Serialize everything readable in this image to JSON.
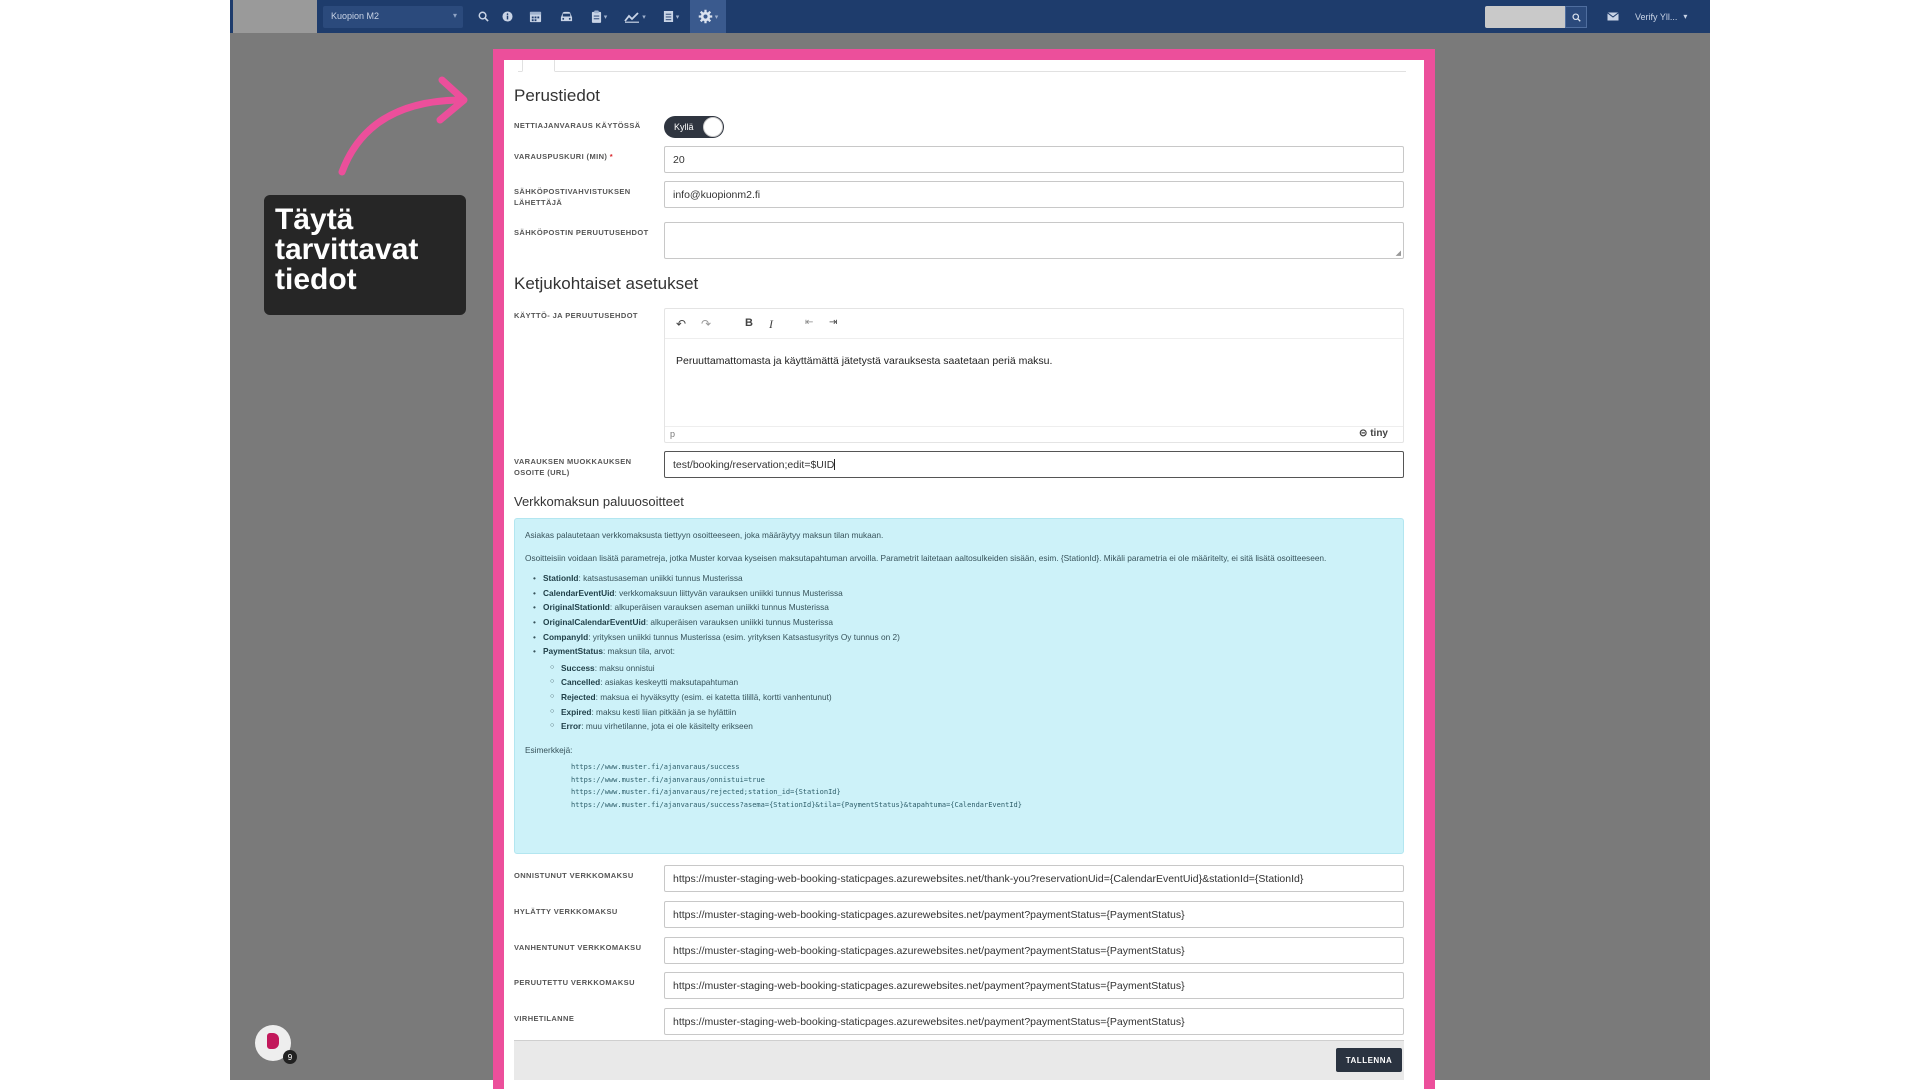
{
  "topbar": {
    "station": "Kuopion M2",
    "user": "Verify Yll...",
    "icons": [
      "search-icon",
      "info-icon",
      "calendar-icon",
      "car-icon",
      "clipboard-icon",
      "chart-icon",
      "list-icon",
      "gear-icon"
    ]
  },
  "annotation": {
    "callout_line1": "Täytä",
    "callout_line2": "tarvittavat",
    "callout_line3": "tiedot",
    "arrow_color": "#ec4f9b",
    "help_badge": "9"
  },
  "form": {
    "section_basic": "Perustiedot",
    "online_booking_label": "NETTIAJANVARAUS KÄYTÖSSÄ",
    "online_booking_value": "Kyllä",
    "buffer_label": "VARAUSPUSKURI (MIN)",
    "buffer_required": "*",
    "buffer_value": "20",
    "email_sender_label": "SÄHKÖPOSTIVAHVISTUKSEN LÄHETTÄJÄ",
    "email_sender_value": "info@kuopionm2.fi",
    "email_cancel_label": "SÄHKÖPOSTIN PERUUTUSEHDOT",
    "section_chain": "Ketjukohtaiset asetukset",
    "terms_label": "KÄYTTÖ- JA PERUUTUSEHDOT",
    "terms_text": "Peruuttamattomasta ja käyttämättä jätetystä varauksesta saatetaan periä maksu.",
    "editor_path": "p",
    "editor_brand": "tiny",
    "edit_url_label": "VARAUKSEN MUOKKAUKSEN OSOITE (URL)",
    "edit_url_value": "test/booking/reservation;edit=$UID",
    "section_payment": "Verkkomaksun paluuosoitteet",
    "info_p1": "Asiakas palautetaan verkkomaksusta tiettyyn osoitteeseen, joka määräytyy maksun tilan mukaan.",
    "info_p2": "Osoitteisiin voidaan lisätä parametreja, jotka Muster korvaa kyseisen maksutapahtuman arvoilla. Parametrit laitetaan aaltosulkeiden sisään, esim. {StationId}. Mikäli parametria ei ole määritelty, ei sitä lisätä osoitteeseen.",
    "params": [
      {
        "name": "StationId",
        "desc": ": katsastusaseman uniikki tunnus Musterissa"
      },
      {
        "name": "CalendarEventUid",
        "desc": ": verkkomaksuun liittyvän varauksen uniikki tunnus Musterissa"
      },
      {
        "name": "OriginalStationId",
        "desc": ": alkuperäisen varauksen aseman uniikki tunnus Musterissa"
      },
      {
        "name": "OriginalCalendarEventUid",
        "desc": ": alkuperäisen varauksen uniikki tunnus Musterissa"
      },
      {
        "name": "CompanyId",
        "desc": ": yrityksen uniikki tunnus Musterissa (esim. yrityksen Katsastusyritys Oy tunnus on 2)"
      },
      {
        "name": "PaymentStatus",
        "desc": ": maksun tila, arvot:"
      }
    ],
    "statuses": [
      {
        "name": "Success",
        "desc": ": maksu onnistui"
      },
      {
        "name": "Cancelled",
        "desc": ": asiakas keskeytti maksutapahtuman"
      },
      {
        "name": "Rejected",
        "desc": ": maksua ei hyväksytty (esim. ei katetta tilillä, kortti vanhentunut)"
      },
      {
        "name": "Expired",
        "desc": ": maksu kesti liian pitkään ja se hylättiin"
      },
      {
        "name": "Error",
        "desc": ": muu virhetilanne, jota ei ole käsitelty erikseen"
      }
    ],
    "examples_label": "Esimerkkejä:",
    "examples": [
      "https://www.muster.fi/ajanvaraus/success",
      "https://www.muster.fi/ajanvaraus/onnistui=true",
      "https://www.muster.fi/ajanvaraus/rejected;station_id={StationId}",
      "https://www.muster.fi/ajanvaraus/success?asema={StationId}&tila={PaymentStatus}&tapahtuma={CalendarEventId}"
    ],
    "return_urls": [
      {
        "label": "ONNISTUNUT VERKKOMAKSU",
        "value": "https://muster-staging-web-booking-staticpages.azurewebsites.net/thank-you?reservationUid={CalendarEventUid}&stationId={StationId}"
      },
      {
        "label": "HYLÄTTY VERKKOMAKSU",
        "value": "https://muster-staging-web-booking-staticpages.azurewebsites.net/payment?paymentStatus={PaymentStatus}"
      },
      {
        "label": "VANHENTUNUT VERKKOMAKSU",
        "value": "https://muster-staging-web-booking-staticpages.azurewebsites.net/payment?paymentStatus={PaymentStatus}"
      },
      {
        "label": "PERUUTETTU VERKKOMAKSU",
        "value": "https://muster-staging-web-booking-staticpages.azurewebsites.net/payment?paymentStatus={PaymentStatus}"
      },
      {
        "label": "VIRHETILANNE",
        "value": "https://muster-staging-web-booking-staticpages.azurewebsites.net/payment?paymentStatus={PaymentStatus}"
      }
    ],
    "save_label": "TALLENNA"
  }
}
